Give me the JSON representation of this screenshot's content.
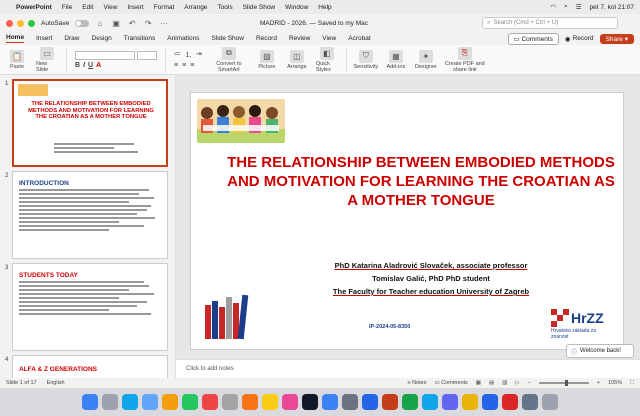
{
  "menubar": {
    "app_name": "PowerPoint",
    "items": [
      "File",
      "Edit",
      "View",
      "Insert",
      "Format",
      "Arrange",
      "Tools",
      "Slide Show",
      "Window",
      "Help"
    ],
    "datetime": "pet 7. kol 21:07"
  },
  "titlebar": {
    "autosave_label": "AutoSave",
    "autosave_state": "OFF",
    "doc_title": "MADRID - 2026. — Saved to my Mac",
    "search_placeholder": "Search (Cmd + Ctrl + U)"
  },
  "tabs": {
    "items": [
      "Home",
      "Insert",
      "Draw",
      "Design",
      "Transitions",
      "Animations",
      "Slide Show",
      "Record",
      "Review",
      "View",
      "Acrobat"
    ],
    "active": "Home",
    "comments": "Comments",
    "record": "Record",
    "share": "Share"
  },
  "ribbon": {
    "paste": "Paste",
    "new_slide": "New Slide",
    "convert": "Convert to SmartArt",
    "picture": "Picture",
    "arrange": "Arrange",
    "quick_styles": "Quick Styles",
    "sensitivity": "Sensitivity",
    "addins": "Add-ins",
    "designer": "Designer",
    "create_pdf": "Create PDF and share link"
  },
  "thumbnails": [
    {
      "num": "1",
      "title": "THE RELATIONSHIP BETWEEN EMBODIED METHODS AND MOTIVATION FOR LEARNING THE CROATIAN AS A MOTHER TONGUE"
    },
    {
      "num": "2",
      "heading": "INTRODUCTION"
    },
    {
      "num": "3",
      "heading": "STUDENTS TODAY"
    },
    {
      "num": "4",
      "heading": "ALFA & Z GENERATIONS"
    }
  ],
  "slide": {
    "title": "THE RELATIONSHIP BETWEEN EMBODIED METHODS AND MOTIVATION FOR LEARNING THE CROATIAN AS A MOTHER TONGUE",
    "author1": "PhD Katarina Aladrović Slovaček, associate professor",
    "author2": "Tomislav Galić, PhD PhD student",
    "faculty": "The Faculty for Teacher education University of Zagreb",
    "code": "IP-2024-05-8350",
    "logo_text": "HrZZ",
    "logo_sub": "Hrvatska zaklada za znanost"
  },
  "notes_placeholder": "Click to add notes",
  "toast": "Welcome back!",
  "status": {
    "slide": "Slide 1 of 17",
    "language": "English",
    "notes": "Notes",
    "comments": "Comments",
    "zoom": "105%"
  },
  "colors": {
    "accent": "#c43e1c",
    "title_red": "#cc0000",
    "navy": "#1c3d8a"
  },
  "dock_icons": [
    "finder-icon",
    "launchpad-icon",
    "safari-icon",
    "mail-icon",
    "photos-icon",
    "facetime-icon",
    "calendar-icon",
    "contacts-icon",
    "reminders-icon",
    "notes-icon",
    "music-icon",
    "tv-icon",
    "appstore-icon",
    "settings-icon",
    "word-icon",
    "powerpoint-icon",
    "excel-icon",
    "outlook-icon",
    "teams-icon",
    "chrome-icon",
    "zoom-icon",
    "acrobat-icon",
    "preview-icon",
    "trash-icon"
  ]
}
